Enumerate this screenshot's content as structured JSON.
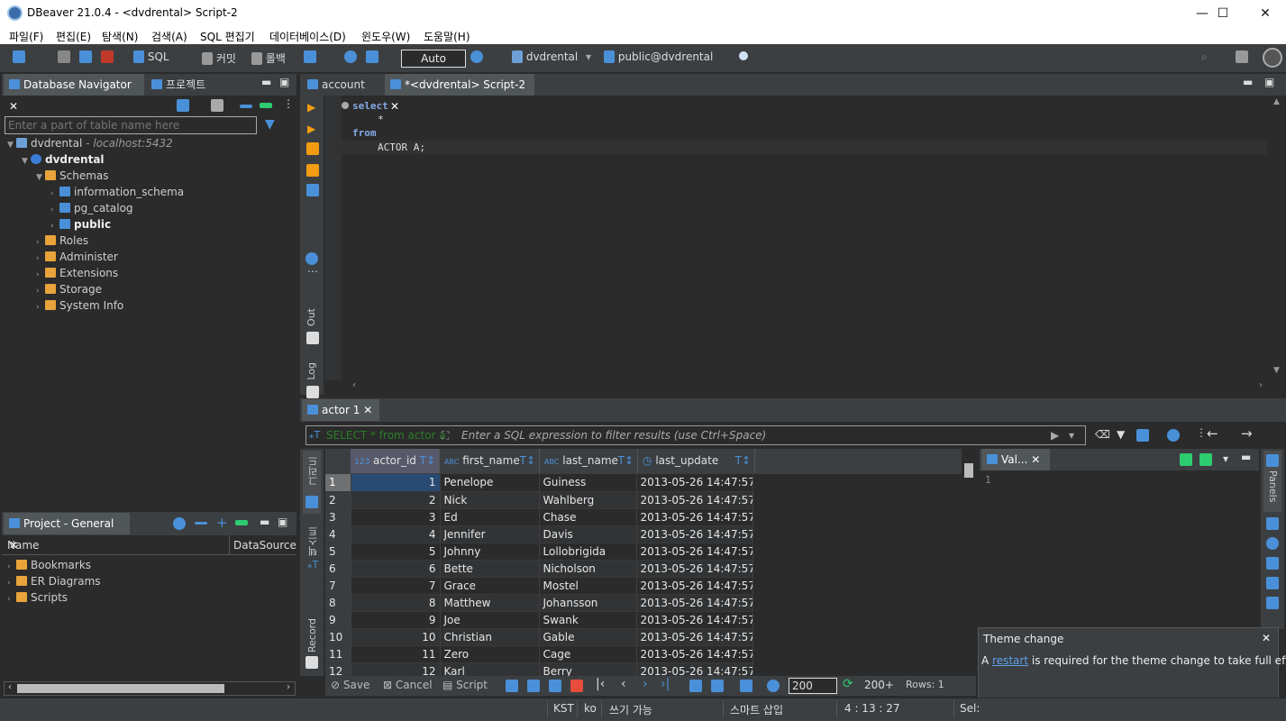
{
  "window": {
    "title": "DBeaver 21.0.4 - <dvdrental> Script-2",
    "minimize": "—",
    "maximize": "☐",
    "close": "✕"
  },
  "menu": [
    "파일(F)",
    "편집(E)",
    "탐색(N)",
    "검색(A)",
    "SQL 편집기",
    "데이터베이스(D)",
    "윈도우(W)",
    "도움말(H)"
  ],
  "toolbar": {
    "sql": "SQL",
    "commit": "커밋",
    "rollback": "롤백",
    "auto": "Auto",
    "connection": "dvdrental",
    "schema": "public@dvdrental"
  },
  "navigator": {
    "tab": "Database Navigator",
    "tab2": "프로젝트",
    "filter_placeholder": "Enter a part of table name here",
    "connection": "dvdrental",
    "host": "- localhost:5432",
    "database": "dvdrental",
    "schemas": "Schemas",
    "schema_items": [
      "information_schema",
      "pg_catalog",
      "public"
    ],
    "other": [
      "Roles",
      "Administer",
      "Extensions",
      "Storage",
      "System Info"
    ]
  },
  "project": {
    "tab": "Project - General",
    "col_name": "Name",
    "col_ds": "DataSource",
    "items": [
      "Bookmarks",
      "ER Diagrams",
      "Scripts"
    ]
  },
  "editor": {
    "tabs": [
      "account",
      "*<dvdrental> Script-2"
    ],
    "lines": [
      "select",
      "*",
      "from",
      "ACTOR A;"
    ],
    "side_labels": [
      "Out",
      "Log"
    ]
  },
  "results": {
    "tab": "actor 1",
    "query": "SELECT * from actor a",
    "filter_placeholder": "Enter a SQL expression to filter results (use Ctrl+Space)",
    "columns": [
      "actor_id",
      "first_name",
      "last_name",
      "last_update"
    ],
    "col_types": [
      "123",
      "ABC",
      "ABC",
      ""
    ],
    "rows": [
      [
        "1",
        "1",
        "Penelope",
        "Guiness",
        "2013-05-26 14:47:57"
      ],
      [
        "2",
        "2",
        "Nick",
        "Wahlberg",
        "2013-05-26 14:47:57"
      ],
      [
        "3",
        "3",
        "Ed",
        "Chase",
        "2013-05-26 14:47:57"
      ],
      [
        "4",
        "4",
        "Jennifer",
        "Davis",
        "2013-05-26 14:47:57"
      ],
      [
        "5",
        "5",
        "Johnny",
        "Lollobrigida",
        "2013-05-26 14:47:57"
      ],
      [
        "6",
        "6",
        "Bette",
        "Nicholson",
        "2013-05-26 14:47:57"
      ],
      [
        "7",
        "7",
        "Grace",
        "Mostel",
        "2013-05-26 14:47:57"
      ],
      [
        "8",
        "8",
        "Matthew",
        "Johansson",
        "2013-05-26 14:47:57"
      ],
      [
        "9",
        "9",
        "Joe",
        "Swank",
        "2013-05-26 14:47:57"
      ],
      [
        "10",
        "10",
        "Christian",
        "Gable",
        "2013-05-26 14:47:57"
      ],
      [
        "11",
        "11",
        "Zero",
        "Cage",
        "2013-05-26 14:47:57"
      ],
      [
        "12",
        "12",
        "Karl",
        "Berry",
        "2013-05-26 14:47:57"
      ]
    ],
    "side_labels": [
      "그리드",
      "텍스트",
      "Record"
    ],
    "bottom": {
      "save": "Save",
      "cancel": "Cancel",
      "script": "Script",
      "fetch": "200",
      "more": "200+",
      "rows": "Rows: 1"
    }
  },
  "value_panel": {
    "tab": "Val...",
    "line": "1",
    "panels_label": "Panels"
  },
  "notification": {
    "title": "Theme change",
    "pre": "A ",
    "link": "restart",
    "post": " is required for the theme change to take full effect."
  },
  "status": {
    "tz": "KST",
    "lang": "ko",
    "mode": "쓰기 가능",
    "insert": "스마트 삽입",
    "pos": "4 : 13 : 27",
    "sel": "Sel:"
  },
  "colors": {
    "accent": "#2f65ca",
    "selected_cell": "#284a73",
    "bg": "#2b2b2b",
    "panel": "#3c3f41",
    "keyword": "#86a9e8"
  }
}
